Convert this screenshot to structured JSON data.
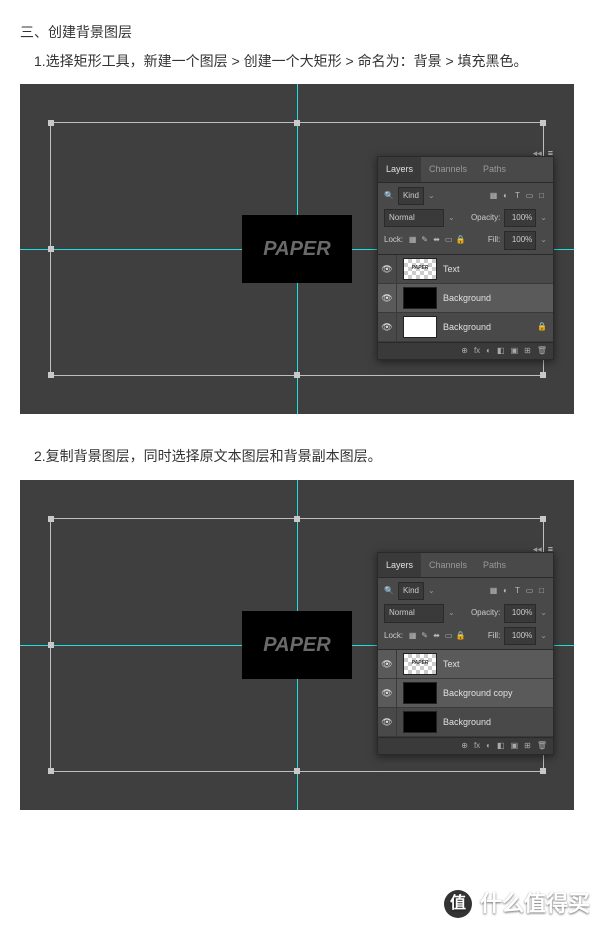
{
  "section_title": "三、创建背景图层",
  "step1": "1.选择矩形工具，新建一个图层 > 创建一个大矩形 > 命名为：背景 > 填充黑色。",
  "step2": "2.复制背景图层，同时选择原文本图层和背景副本图层。",
  "canvas_text": "PAPER",
  "panel": {
    "tabs": [
      "Layers",
      "Channels",
      "Paths"
    ],
    "kind": "Kind",
    "blend": "Normal",
    "opacity_label": "Opacity:",
    "opacity_value": "100%",
    "lock_label": "Lock:",
    "fill_label": "Fill:",
    "fill_value": "100%",
    "toolbar_icons": [
      "▦",
      "◐",
      "T",
      "▭",
      "□",
      "◉"
    ],
    "lock_icons": [
      "▦",
      "✎",
      "⬌",
      "▭",
      "🔒"
    ],
    "footer_icons": [
      "⊕",
      "fx",
      "◐",
      "◧",
      "▣",
      "⊞",
      "🗑"
    ]
  },
  "layers_img1": [
    {
      "thumb": "checker",
      "name": "Text",
      "sel": false,
      "lock": false
    },
    {
      "thumb": "black",
      "name": "Background",
      "sel": true,
      "lock": false
    },
    {
      "thumb": "white",
      "name": "Background",
      "sel": false,
      "lock": true
    }
  ],
  "layers_img2": [
    {
      "thumb": "checker",
      "name": "Text",
      "sel": true,
      "lock": false
    },
    {
      "thumb": "black",
      "name": "Background copy",
      "sel": true,
      "lock": false
    },
    {
      "thumb": "black",
      "name": "Background",
      "sel": false,
      "lock": false
    }
  ],
  "watermark": {
    "badge": "值",
    "text": "什么值得买"
  }
}
